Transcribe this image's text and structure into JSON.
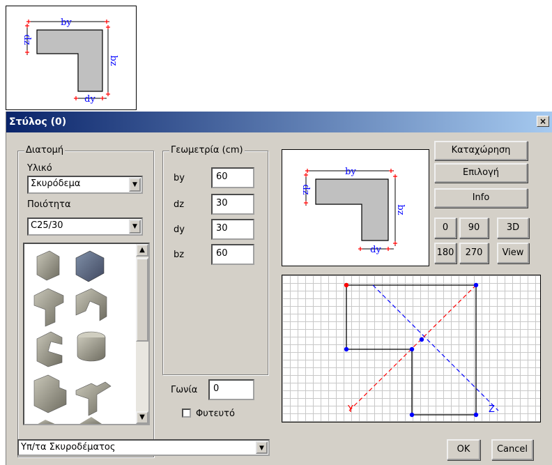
{
  "section_preview_labels": {
    "by": "by",
    "dz": "dz",
    "dy": "dy",
    "bz": "bz"
  },
  "dialog": {
    "title": "Στύλος (0)",
    "close": "×"
  },
  "cross_section": {
    "legend": "Διατομή",
    "material_label": "Υλικό",
    "material_value": "Σκυρόδεμα",
    "quality_label": "Ποιότητα",
    "quality_value": "C25/30"
  },
  "geometry": {
    "legend": "Γεωμετρία (cm)",
    "fields": [
      {
        "label": "by",
        "value": "60"
      },
      {
        "label": "dz",
        "value": "30"
      },
      {
        "label": "dy",
        "value": "30"
      },
      {
        "label": "bz",
        "value": "60"
      }
    ]
  },
  "angle": {
    "label": "Γωνία",
    "value": "0"
  },
  "planted": {
    "label": "Φυτευτό",
    "checked": false
  },
  "buttons": {
    "register": "Καταχώρηση",
    "select": "Επιλογή",
    "info": "Info",
    "rot0": "0",
    "rot90": "90",
    "view3d": "3D",
    "rot180": "180",
    "rot270": "270",
    "view": "View",
    "ok": "OK",
    "cancel": "Cancel"
  },
  "grid_axes": {
    "y": "Y",
    "z": "Z"
  },
  "bottom_combo": {
    "value": "Υπ/τα Σκυροδέματος"
  },
  "colors": {
    "dim_text": "#0000ff",
    "dim_marker": "#ff0000",
    "shape_fill": "#c0c0c0",
    "axis_y": "#ff0000",
    "axis_z": "#0000ff"
  }
}
